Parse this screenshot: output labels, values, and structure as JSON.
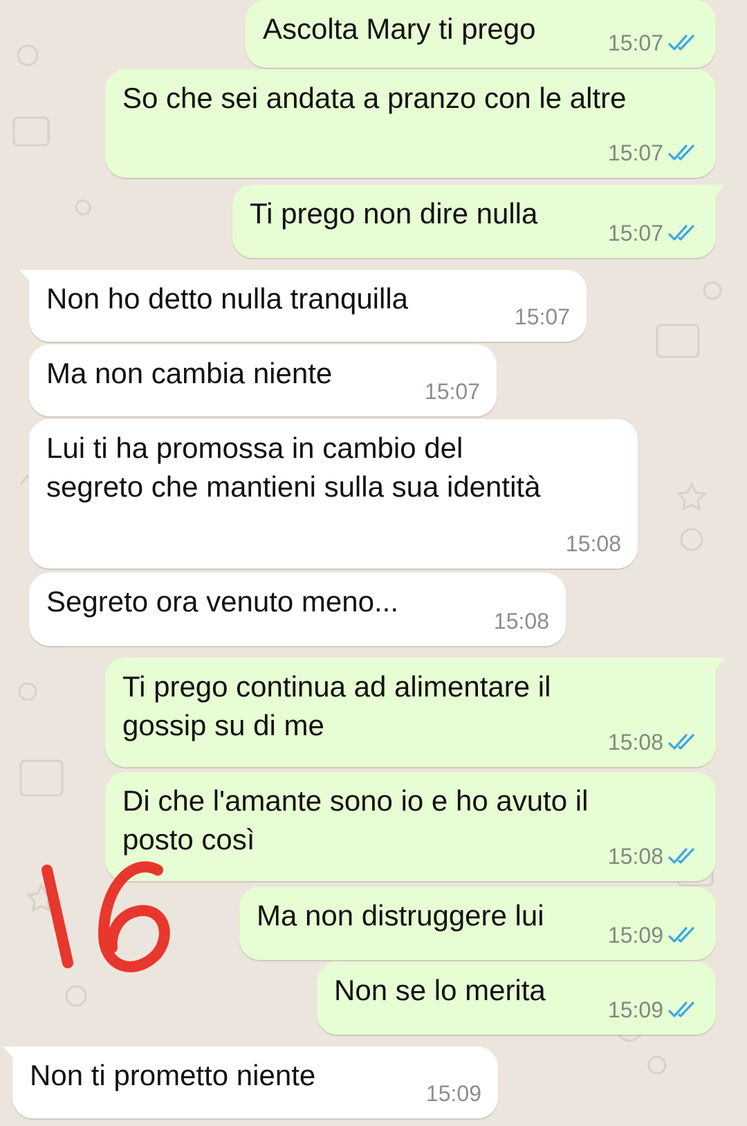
{
  "messages": [
    {
      "direction": "out",
      "text": "Ascolta Mary ti prego",
      "time": "15:07",
      "status_icon": "double-check-read-icon"
    },
    {
      "direction": "out",
      "text": "So che sei andata a pranzo con le altre",
      "time": "15:07",
      "status_icon": "double-check-read-icon"
    },
    {
      "direction": "out",
      "text": "Ti prego non dire nulla",
      "time": "15:07",
      "status_icon": "double-check-read-icon"
    },
    {
      "direction": "in",
      "text": "Non ho detto nulla tranquilla",
      "time": "15:07"
    },
    {
      "direction": "in",
      "text": "Ma non cambia niente",
      "time": "15:07"
    },
    {
      "direction": "in",
      "text": "Lui ti ha promossa in cambio del\nsegreto che mantieni sulla sua identità",
      "time": "15:08"
    },
    {
      "direction": "in",
      "text": "Segreto ora venuto meno...",
      "time": "15:08"
    },
    {
      "direction": "out",
      "text": "Ti prego continua ad alimentare il\ngossip su di me",
      "time": "15:08",
      "status_icon": "double-check-read-icon"
    },
    {
      "direction": "out",
      "text": "Di che l'amante sono io e ho avuto il\nposto così",
      "time": "15:08",
      "status_icon": "double-check-read-icon"
    },
    {
      "direction": "out",
      "text": "Ma non distruggere lui",
      "time": "15:09",
      "status_icon": "double-check-read-icon"
    },
    {
      "direction": "out",
      "text": "Non se lo merita",
      "time": "15:09",
      "status_icon": "double-check-read-icon"
    },
    {
      "direction": "in",
      "text": "Non ti prometto niente",
      "time": "15:09"
    }
  ],
  "annotation": {
    "text": "16",
    "color": "#e8372c"
  },
  "colors": {
    "background": "#ece5dd",
    "outgoing_bubble": "#e7fdd3",
    "incoming_bubble": "#ffffff",
    "read_tick": "#3aa7e6"
  }
}
